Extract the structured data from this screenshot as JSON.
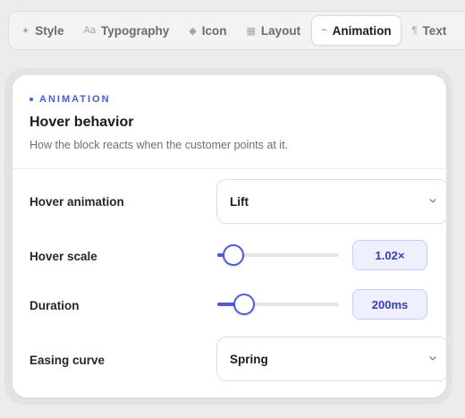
{
  "tabs": [
    {
      "icon": "✦",
      "label": "Style",
      "active": false
    },
    {
      "icon": "Aa",
      "label": "Typography",
      "active": false
    },
    {
      "icon": "◆",
      "label": "Icon",
      "active": false
    },
    {
      "icon": "▦",
      "label": "Layout",
      "active": false
    },
    {
      "icon": "~",
      "label": "Animation",
      "active": true
    },
    {
      "icon": "¶",
      "label": "Text",
      "active": false
    }
  ],
  "section": {
    "eyebrow": "ANIMATION",
    "title": "Hover behavior",
    "subtitle": "How the block reacts when the customer points at it."
  },
  "fields": {
    "hover_animation": {
      "label": "Hover animation",
      "value": "Lift"
    },
    "hover_scale": {
      "label": "Hover scale",
      "value_text": "1.02×",
      "level": 0.13
    },
    "duration": {
      "label": "Duration",
      "value_text": "200ms",
      "level": 0.22
    },
    "easing_curve": {
      "label": "Easing curve",
      "value": "Spring"
    }
  },
  "colors": {
    "accent": "#4f5bd5",
    "pill_bg": "#eef0fd",
    "pill_text": "#3340b5"
  }
}
